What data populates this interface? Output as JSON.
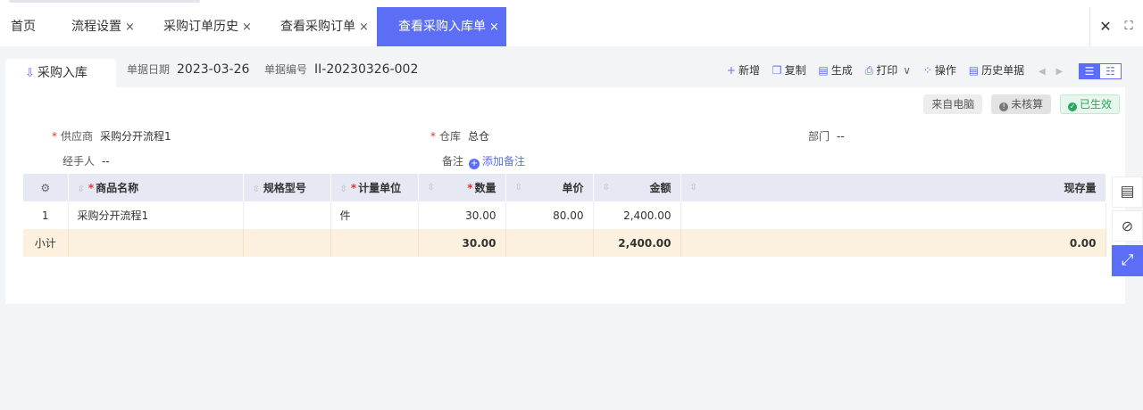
{
  "tabs": [
    {
      "label": "首页",
      "closable": false
    },
    {
      "label": "流程设置",
      "closable": true
    },
    {
      "label": "采购订单历史",
      "closable": true
    },
    {
      "label": "查看采购订单",
      "closable": true
    },
    {
      "label": "查看采购入库单",
      "closable": true,
      "active": true
    }
  ],
  "tab_close_glyph": "×",
  "window": {
    "close_glyph": "✕",
    "fullscreen_glyph": "⛶"
  },
  "doc": {
    "title": "采购入库",
    "date_label": "单据日期",
    "date_value": "2023-03-26",
    "no_label": "单据编号",
    "no_value": "II-20230326-002"
  },
  "toolbar": {
    "new": "新增",
    "copy": "复制",
    "generate": "生成",
    "print": "打印",
    "operate": "操作",
    "history": "历史单据"
  },
  "badges": {
    "source": "来自电脑",
    "unchecked": "未核算",
    "effective": "已生效"
  },
  "form": {
    "supplier_label": "供应商",
    "supplier_value": "采购分开流程1",
    "warehouse_label": "仓库",
    "warehouse_value": "总仓",
    "dept_label": "部门",
    "dept_value": "--",
    "handler_label": "经手人",
    "handler_value": "--",
    "remark_label": "备注",
    "remark_add": "添加备注"
  },
  "table": {
    "headers": {
      "name": "商品名称",
      "spec": "规格型号",
      "unit": "计量单位",
      "qty": "数量",
      "price": "单价",
      "amount": "金额",
      "stock": "现存量"
    },
    "rows": [
      {
        "idx": "1",
        "name": "采购分开流程1",
        "spec": "",
        "unit": "件",
        "qty": "30.00",
        "price": "80.00",
        "amount": "2,400.00",
        "stock": ""
      }
    ],
    "subtotal": {
      "label": "小计",
      "qty": "30.00",
      "amount": "2,400.00",
      "stock": "0.00"
    }
  },
  "colors": {
    "accent": "#5b6ef5",
    "required": "#e5322d",
    "effective": "#26a65b",
    "subtotal_bg": "#fcf1df"
  }
}
